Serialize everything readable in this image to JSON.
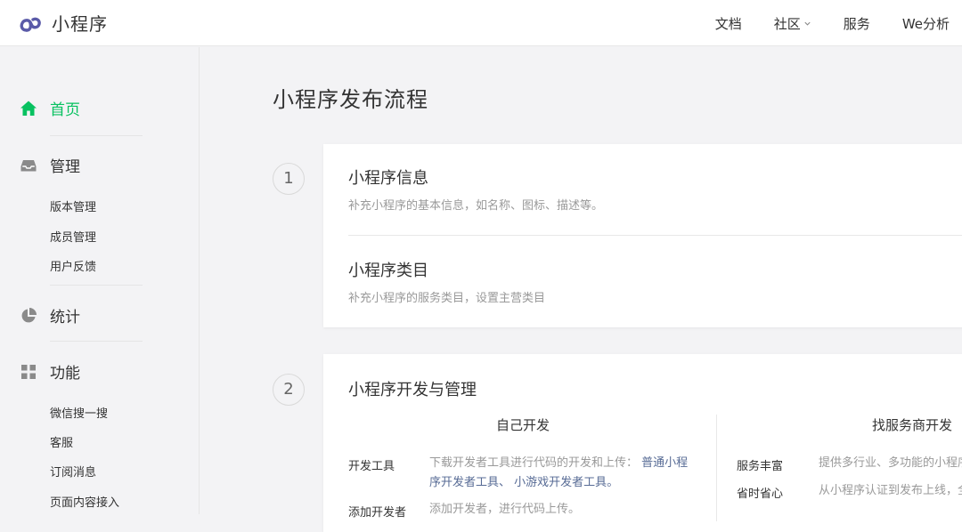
{
  "header": {
    "brand": "小程序",
    "nav": [
      {
        "label": "文档",
        "has_dropdown": false
      },
      {
        "label": "社区",
        "has_dropdown": true
      },
      {
        "label": "服务",
        "has_dropdown": false
      },
      {
        "label": "We分析",
        "has_dropdown": false
      }
    ],
    "brand_color": "#5a5aa8"
  },
  "sidebar": {
    "home": {
      "label": "首页",
      "icon": "home-icon",
      "active": true
    },
    "manage": {
      "label": "管理",
      "icon": "inbox-icon"
    },
    "manage_items": [
      "版本管理",
      "成员管理",
      "用户反馈"
    ],
    "stats": {
      "label": "统计",
      "icon": "pie-chart-icon"
    },
    "features": {
      "label": "功能",
      "icon": "grid-icon"
    },
    "feature_items": [
      "微信搜一搜",
      "客服",
      "订阅消息",
      "页面内容接入"
    ],
    "active_color": "#07c160"
  },
  "main": {
    "title": "小程序发布流程",
    "step1": {
      "number": "1",
      "items": [
        {
          "title": "小程序信息",
          "desc": "补充小程序的基本信息，如名称、图标、描述等。"
        },
        {
          "title": "小程序类目",
          "desc": "补充小程序的服务类目，设置主营类目"
        }
      ]
    },
    "step2": {
      "number": "2",
      "title": "小程序开发与管理",
      "left_col": {
        "heading": "自己开发",
        "rows": [
          {
            "label": "开发工具",
            "desc_prefix": "下载开发者工具进行代码的开发和上传：",
            "link1_line1": "普通小程",
            "link1_line2": "序开发者工具",
            "sep": "、",
            "link2": "小游戏开发者工具",
            "suffix": "。"
          },
          {
            "label": "添加开发者",
            "desc": "添加开发者，进行代码上传。"
          }
        ]
      },
      "right_col": {
        "heading": "找服务商开发",
        "rows": [
          {
            "label": "服务丰富",
            "desc": "提供多行业、多功能的小程序开发服务"
          },
          {
            "label": "省时省心",
            "desc": "从小程序认证到发布上线，全程服务"
          }
        ]
      }
    },
    "link_color": "#576b95"
  }
}
